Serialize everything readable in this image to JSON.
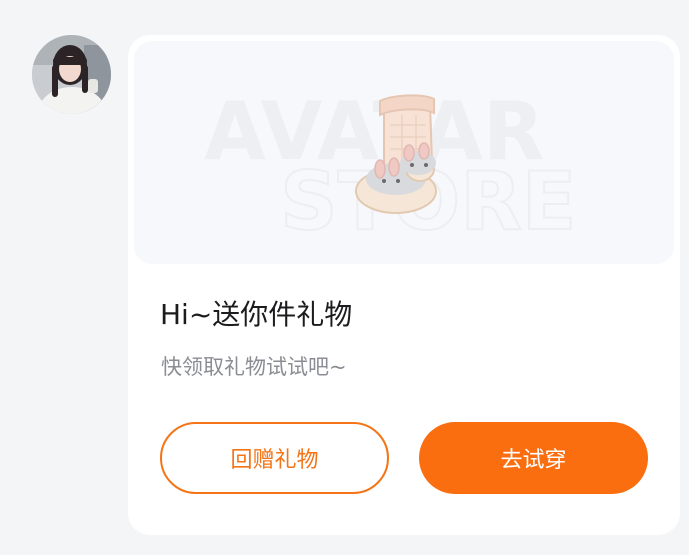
{
  "avatar": {
    "icon": "user-avatar-photo"
  },
  "banner": {
    "watermark_line1": "AVATAR",
    "watermark_line2": "STORE",
    "gift_item": "bunny-slipper-sock-icon"
  },
  "card": {
    "title": "Hi~送你件礼物",
    "subtitle": "快领取礼物试试吧~"
  },
  "actions": {
    "return_gift_label": "回赠礼物",
    "try_on_label": "去试穿"
  },
  "colors": {
    "accent": "#fa6e10",
    "outline": "#f47416",
    "background": "#f4f5f7",
    "card": "#ffffff"
  }
}
